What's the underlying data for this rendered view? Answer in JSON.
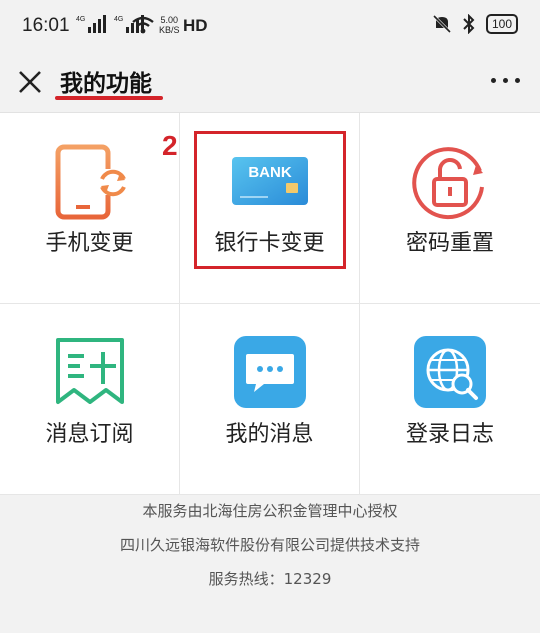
{
  "status_bar": {
    "time": "16:01",
    "network1": "4G",
    "network2": "4G",
    "speed_value": "5.00",
    "speed_unit": "KB/S",
    "hd": "HD",
    "battery": "100",
    "icons": [
      "signal-icon",
      "wifi-icon",
      "mute-icon",
      "bluetooth-icon",
      "battery-icon"
    ]
  },
  "header": {
    "title": "我的功能",
    "accent_color": "#d4242a"
  },
  "annotation": {
    "step": "2"
  },
  "grid": {
    "items": [
      {
        "label": "手机变更",
        "icon": "phone-change-icon"
      },
      {
        "label": "银行卡变更",
        "icon": "bank-card-icon",
        "icon_text": "BANK"
      },
      {
        "label": "密码重置",
        "icon": "unlock-icon"
      },
      {
        "label": "消息订阅",
        "icon": "subscribe-icon"
      },
      {
        "label": "我的消息",
        "icon": "message-icon"
      },
      {
        "label": "登录日志",
        "icon": "globe-search-icon"
      }
    ]
  },
  "footer": {
    "line1": "本服务由北海住房公积金管理中心授权",
    "line2": "四川久远银海软件股份有限公司提供技术支持",
    "line3": "服务热线：12329"
  }
}
